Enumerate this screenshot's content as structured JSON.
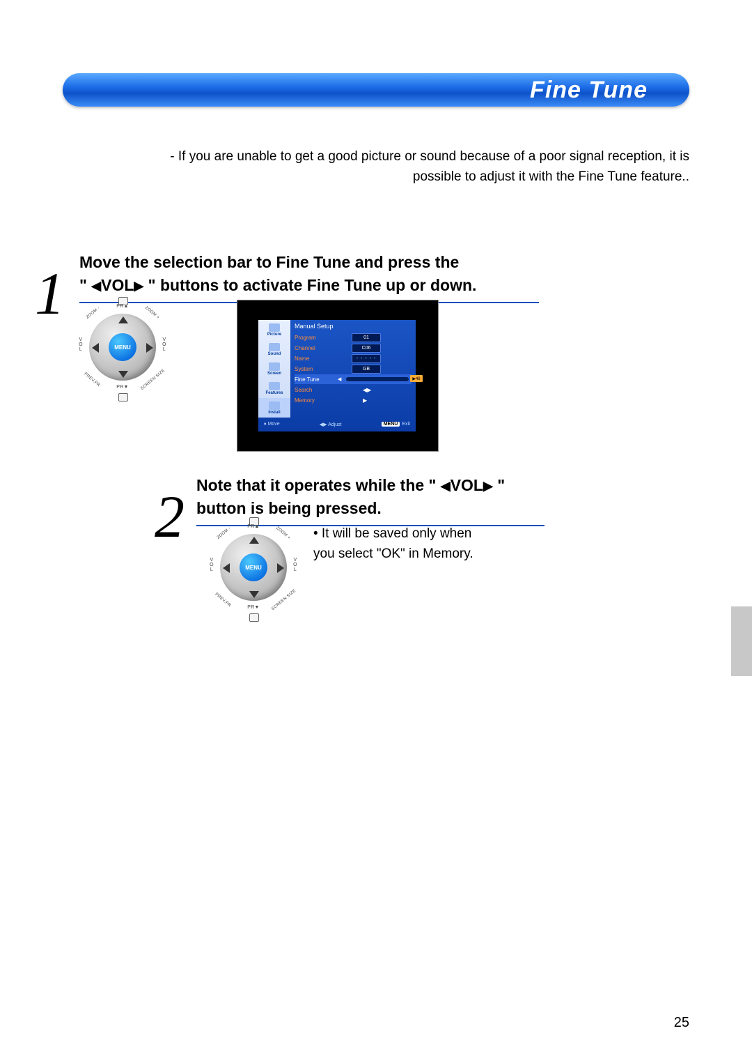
{
  "page_number": "25",
  "banner": {
    "title": "Fine Tune"
  },
  "intro": "- If you are unable to get a good picture or sound because of a poor signal reception, it is possible to adjust it with the Fine Tune feature..",
  "step1": {
    "number": "1",
    "heading_a": "Move the selection bar to Fine Tune and press the",
    "heading_b_prefix": "\" ",
    "heading_b_mid": "VOL",
    "heading_b_suffix": " \" buttons to activate Fine Tune up or down."
  },
  "step2": {
    "number": "2",
    "heading_a_prefix": "Note that it operates while the \" ",
    "heading_a_mid": "VOL",
    "heading_a_suffix": " \"",
    "heading_b": "button is being pressed.",
    "bullet": "• It will be saved only when you select \"OK\" in Memory."
  },
  "remote": {
    "center": "MENU",
    "vol_l": "V\nO\nL",
    "vol_r": "V\nO\nL",
    "pr_t": "PR▲",
    "pr_b": "PR▼",
    "zoom_minus": "ZOOM -",
    "zoom_plus": "ZOOM +",
    "prev_pr": "PREV.PR",
    "screen_size": "SCREEN SIZE"
  },
  "osd": {
    "title": "Manual Setup",
    "sidebar": [
      "Picture",
      "Sound",
      "Screen",
      "Features",
      "Install"
    ],
    "rows": {
      "program": {
        "label": "Program",
        "value": "01"
      },
      "channel": {
        "label": "Channel",
        "value": "C06"
      },
      "name": {
        "label": "Name",
        "value": "- - - - -"
      },
      "system": {
        "label": "System",
        "value": "GB"
      },
      "finetune": {
        "label": "Fine Tune",
        "tag": "▶48"
      },
      "search": {
        "label": "Search",
        "value": "◀▶"
      },
      "memory": {
        "label": "Memory",
        "value": "▶"
      }
    },
    "footer": {
      "move": "Move",
      "adjust": "Adjust",
      "menu_chip": "MENU",
      "exit": "Exit"
    }
  }
}
